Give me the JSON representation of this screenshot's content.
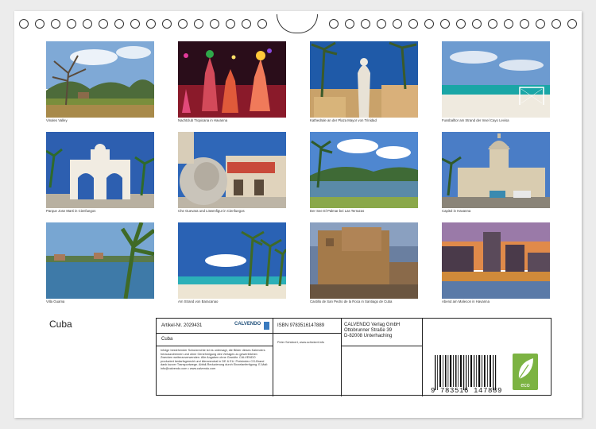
{
  "calendar": {
    "title": "Cuba",
    "photos": [
      {
        "caption": "Vinales Valley"
      },
      {
        "caption": "Nachtclub Tropicana in Havanna"
      },
      {
        "caption": "Kathedrale an der Plaza Mayor von Trinidad"
      },
      {
        "caption": "Fussballtor am Strand der Insel Cayo Levisa"
      },
      {
        "caption": "Parque Jose Marti in Cienfuegos"
      },
      {
        "caption": "Che Guevara und Löwenfigur in Cienfuegos"
      },
      {
        "caption": "Der See El Palmar bei Las Terrazas"
      },
      {
        "caption": "Capitol in Havanna"
      },
      {
        "caption": "Villa Guama"
      },
      {
        "caption": "Am Strand von Baracanao"
      },
      {
        "caption": "Castillo de San Pedro de la Roca in Santiago de Cuba"
      },
      {
        "caption": "Abend am Malecon in Havanna"
      }
    ]
  },
  "info": {
    "article": "Artikel-Nr. 2029431",
    "product_title": "Cuba",
    "legal_text": "Infolge bestehender Schutzrechte ist es untersagt, die Bilder dieses Kalenders herauszutrennen und ohne Genehmigung des Verlages zu gewerblichen Zwecken weiterzuverwenden. Alle Angaben ohne Gewähr. CALVENDO produziert bedarfsgerecht und klimaneutral in DE & EU. Preisindex CG-Brand dank kurzer Transportwege. Abfall-Reduzierung durch Einzelanfertigung. E-Mail: info@calvendo.com • www.calvendo.com",
    "isbn": "ISBN 9783516147889",
    "author": "Peter Schickert, www.schickert.info",
    "publisher_line1": "CALVENDO Verlag GmbH",
    "publisher_line2": "Ottobrunner Straße 39",
    "publisher_line3": "D-82008 Unterhaching",
    "barcode_number": "9 783516 147889",
    "logo_text": "CALVENDO",
    "eco_label": "eco"
  },
  "colors": {
    "eco_green": "#7cb342",
    "logo_blue": "#1f4f7a"
  }
}
